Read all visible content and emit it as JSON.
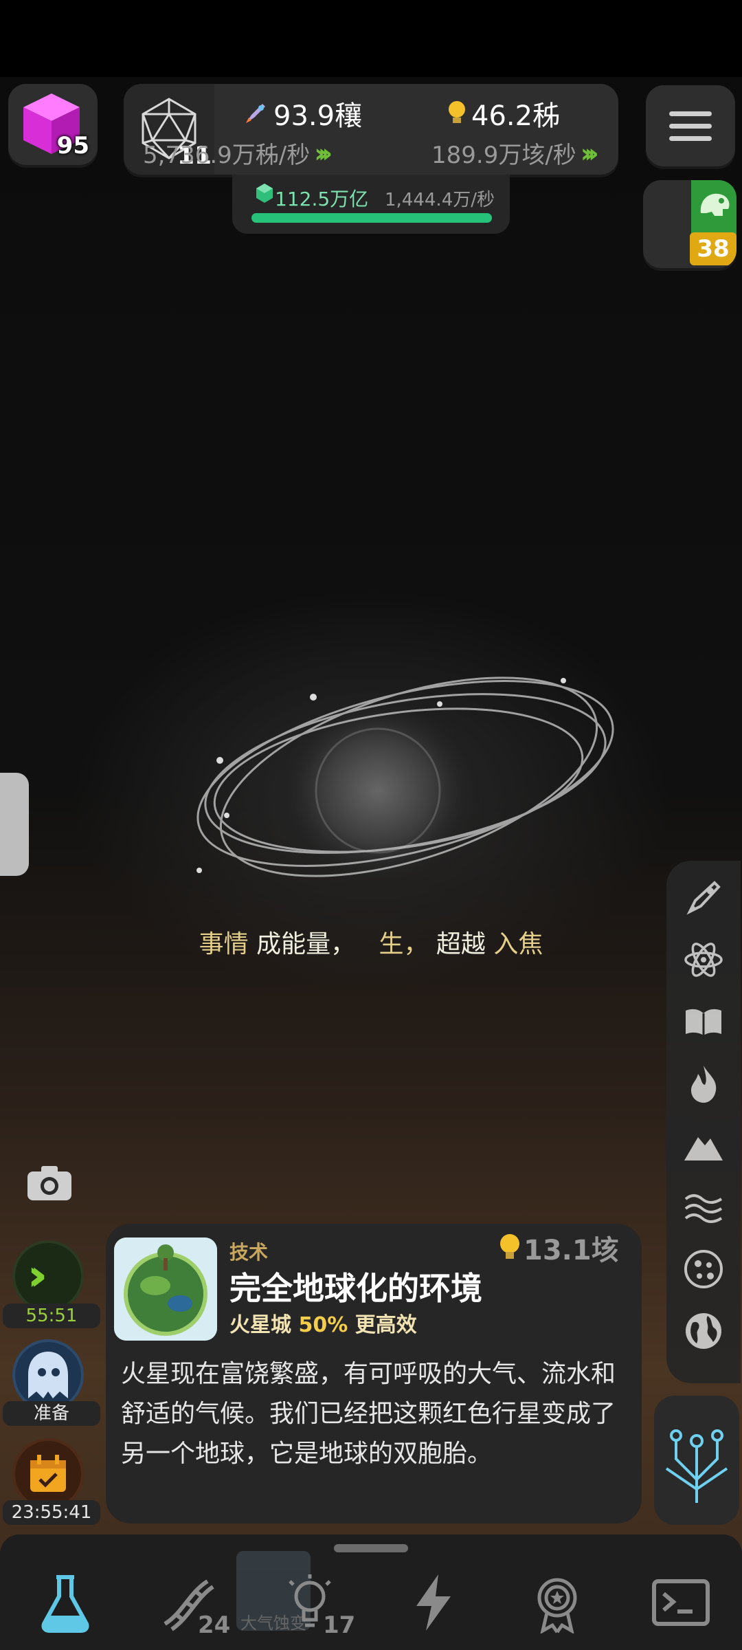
{
  "top_bar": {
    "cube_count": "95",
    "level": "11",
    "resource_1": {
      "icon": "rocket-icon",
      "value": "93.9穰",
      "rate": "5,736.9万秭/秒"
    },
    "resource_2": {
      "icon": "lightbulb-icon",
      "value": "46.2秭",
      "rate": "189.9万垓/秒"
    },
    "sub_resource": {
      "icon": "gem-icon",
      "value": "112.5万亿",
      "rate": "1,444.4万/秒",
      "progress": 1.0
    },
    "dino_count": "38"
  },
  "scene": {
    "caption_parts": [
      "事情",
      "成能量，",
      "生，",
      "超越",
      "入焦"
    ]
  },
  "left_controls": {
    "boost_timer": "55:51",
    "ghost_label": "准备",
    "calendar_timer": "23:55:41"
  },
  "card": {
    "category": "技术",
    "title": "完全地球化的环境",
    "effect_target": "火星城",
    "effect_percent": "50%",
    "effect_text": "更高效",
    "cost": "13.1垓",
    "description": "火星现在富饶繁盛，有可呼吸的大气、流水和舒适的气候。我们已经把这颗红色行星变成了另一个地球，它是地球的双胞胎。"
  },
  "right_bar": {
    "icons": [
      "rocket-icon",
      "atom-icon",
      "book-icon",
      "fire-icon",
      "mountain-icon",
      "waves-icon",
      "cells-icon",
      "globe-icon"
    ],
    "tree_icon": "tree-icon"
  },
  "bottom_nav": {
    "items": [
      {
        "icon": "flask-icon",
        "active": true
      },
      {
        "icon": "dna-icon",
        "count": "24"
      },
      {
        "icon": "lightbulb-icon",
        "count": "17"
      },
      {
        "icon": "lightning-icon"
      },
      {
        "icon": "medal-icon"
      },
      {
        "icon": "terminal-icon"
      }
    ],
    "ghost_label": "大气蚀变"
  },
  "colors": {
    "accent_green": "#6fbf3a",
    "gem_green": "#27c27a",
    "gold": "#e0a812",
    "caption": "#e4cf8a",
    "active_nav": "#5ec8e6"
  }
}
